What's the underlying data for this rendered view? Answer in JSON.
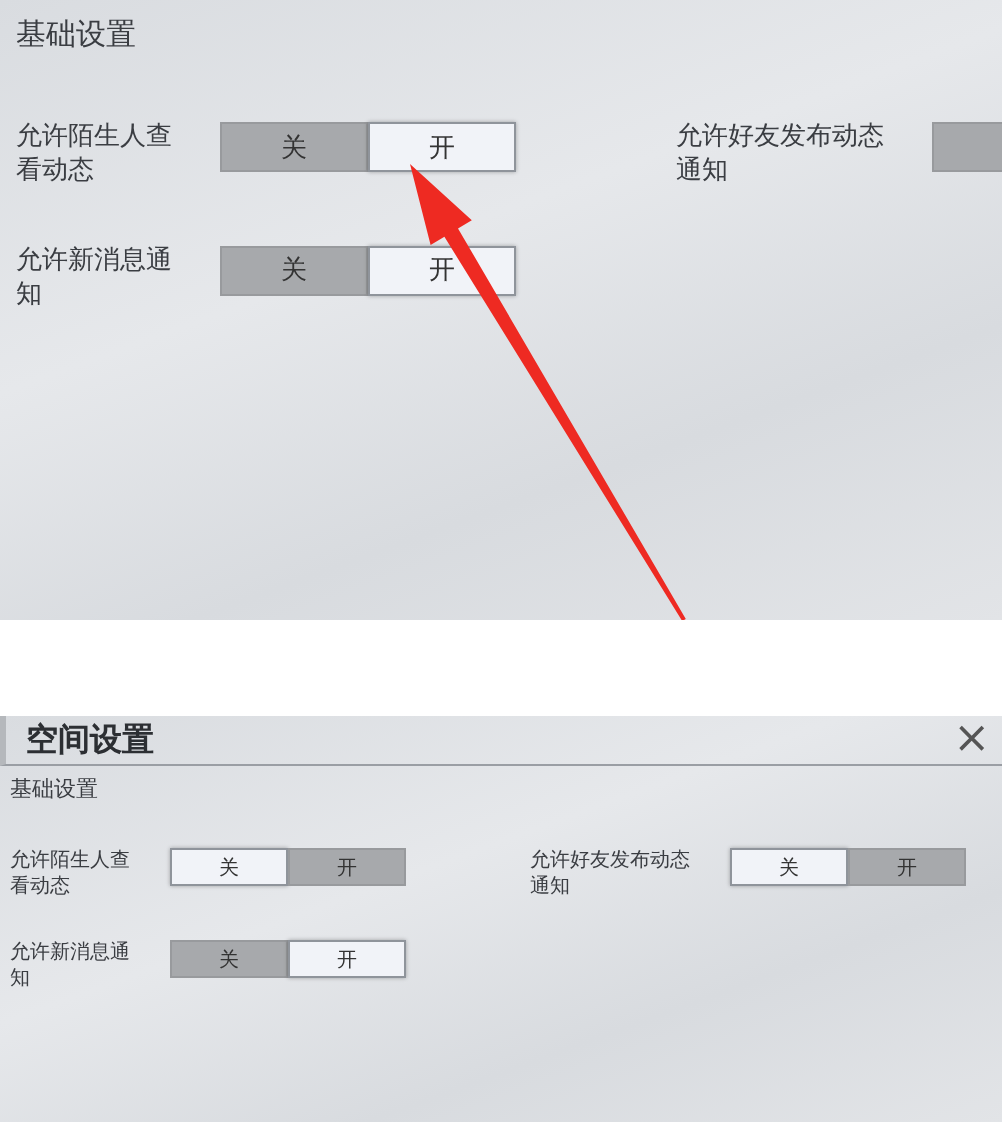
{
  "panels": [
    {
      "kind": "zoomed",
      "section": "基础设置",
      "rows": [
        {
          "label": "允许陌生人查看动态",
          "options": [
            {
              "label": "关",
              "selected": false
            },
            {
              "label": "开",
              "selected": true
            }
          ]
        },
        {
          "label": "允许好友发布动态通知",
          "options": [
            {
              "selected": false
            }
          ]
        },
        {
          "label": "允许新消息通知",
          "options": [
            {
              "label": "关",
              "selected": false
            },
            {
              "label": "开",
              "selected": true
            }
          ]
        }
      ]
    },
    {
      "kind": "full",
      "title": "空间设置",
      "close": "×",
      "section": "基础设置",
      "rows": [
        {
          "label": "允许陌生人查看动态",
          "options": [
            {
              "label": "关",
              "selected": true
            },
            {
              "label": "开",
              "selected": false
            }
          ]
        },
        {
          "label": "允许好友发布动态通知",
          "options": [
            {
              "label": "关",
              "selected": true
            },
            {
              "label": "开",
              "selected": false
            }
          ]
        },
        {
          "label": "允许新消息通知",
          "options": [
            {
              "label": "关",
              "selected": false
            },
            {
              "label": "开",
              "selected": true
            }
          ]
        }
      ]
    }
  ],
  "annotation": {
    "kind": "arrow"
  }
}
